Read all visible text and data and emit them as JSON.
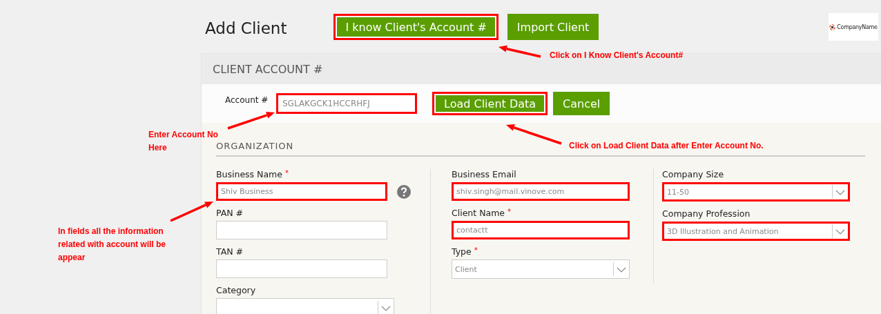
{
  "page_title": "Add Client",
  "header_buttons": [
    {
      "label": "I know Client's Account #",
      "highlighted": true
    },
    {
      "label": "Import Client",
      "highlighted": false
    }
  ],
  "logo": {
    "text": "CompanyName"
  },
  "card": {
    "title": "CLIENT ACCOUNT #",
    "account": {
      "label": "Account #",
      "value": "SGLAKGCK1HCCRHFJ",
      "highlighted": true
    },
    "buttons": [
      {
        "label": "Load Client Data",
        "highlighted": true
      },
      {
        "label": "Cancel",
        "highlighted": false
      }
    ]
  },
  "section": {
    "title": "ORGANIZATION",
    "columns": [
      [
        {
          "kind": "text",
          "label": "Business Name",
          "required_mark": "*",
          "value": "Shiv Business",
          "highlighted": true,
          "help": true
        },
        {
          "kind": "text",
          "label": "PAN #",
          "highlighted": false
        },
        {
          "kind": "text",
          "label": "TAN #",
          "highlighted": false
        },
        {
          "kind": "select",
          "label": "Category",
          "highlighted": false
        }
      ],
      [
        {
          "kind": "text",
          "label": "Business Email",
          "value": "shiv.singh@mail.vinove.com",
          "highlighted": true
        },
        {
          "kind": "text",
          "label": "Client Name",
          "required_mark": "*",
          "value": "contactt",
          "highlighted": true
        },
        {
          "kind": "select",
          "label": "Type",
          "required_mark": "*",
          "value": "Client",
          "highlighted": false
        }
      ],
      [
        {
          "kind": "select",
          "label": "Company Size",
          "value": "11-50",
          "highlighted": true
        },
        {
          "kind": "select",
          "label": "Company Profession",
          "value": "3D Illustration and Animation",
          "highlighted": true
        }
      ]
    ]
  },
  "callouts": [
    {
      "lines": [
        "Click on I Know Client's Account#"
      ]
    },
    {
      "lines": [
        "Enter Account No",
        "Here"
      ]
    },
    {
      "lines": [
        "Click on Load Client Data after Enter Account No."
      ]
    },
    {
      "lines": [
        "In fields all the information",
        "related with account will be",
        "appear"
      ]
    }
  ]
}
